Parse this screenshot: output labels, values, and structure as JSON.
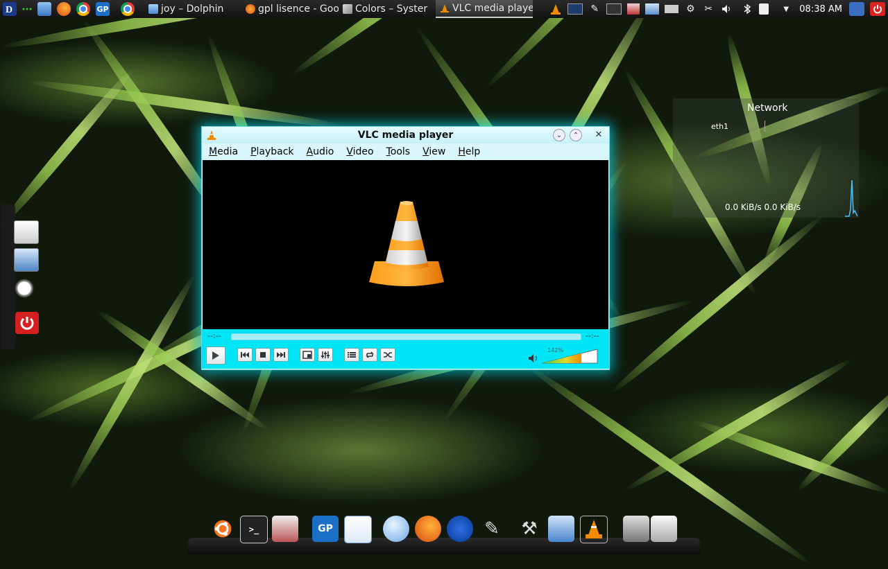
{
  "top_panel": {
    "tasks": [
      {
        "label": "joy – Dolphin",
        "icon": "folder-icon"
      },
      {
        "label": "gpl lisence - Goo",
        "icon": "firefox-icon"
      },
      {
        "label": "Colors – Syster",
        "icon": "colors-icon"
      },
      {
        "label": "VLC media playe",
        "icon": "vlc-cone-icon",
        "active": true
      }
    ],
    "clock": "08:38 AM"
  },
  "network_widget": {
    "title": "Network",
    "interface": "eth1",
    "rate": "0.0 KiB/s   0.0 KiB/s"
  },
  "vlc": {
    "title": "VLC media player",
    "menu": [
      {
        "label": "Media",
        "ul": "M",
        "rest": "edia"
      },
      {
        "label": "Playback",
        "ul": "P",
        "rest": "layback"
      },
      {
        "label": "Audio",
        "ul": "A",
        "rest": "udio"
      },
      {
        "label": "Video",
        "ul": "V",
        "rest": "ideo"
      },
      {
        "label": "Tools",
        "ul": "T",
        "rest": "ools"
      },
      {
        "label": "View",
        "ul": "V",
        "rest": "iew"
      },
      {
        "label": "Help",
        "ul": "H",
        "rest": "elp"
      }
    ],
    "elapsed": "--:--",
    "remaining": "--:--",
    "volume_label": "142%",
    "volume_fraction": 0.71,
    "colors": {
      "accent": "#00e5f5",
      "cone_orange": "#f08a00"
    }
  },
  "dock": {
    "gp_label": "GP"
  }
}
